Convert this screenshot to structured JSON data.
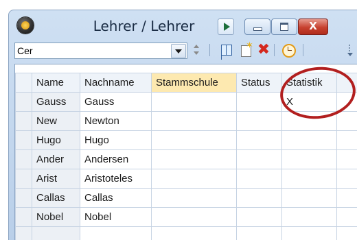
{
  "window": {
    "title": "Lehrer / Lehrer",
    "close_symbol": "X"
  },
  "toolbar": {
    "filter_value": "Cer",
    "icons": [
      "dropdown-arrow-icon",
      "spin-icon",
      "grid-icon",
      "new-record-icon",
      "delete-icon",
      "clock-icon",
      "toolbar-overflow-icon"
    ]
  },
  "table": {
    "columns": [
      "Name",
      "Nachname",
      "Stammschule",
      "Status",
      "Statistik"
    ],
    "rows": [
      {
        "name": "Gauss",
        "nachname": "Gauss",
        "stammschule": "",
        "status": "",
        "statistik": "X"
      },
      {
        "name": "New",
        "nachname": "Newton",
        "stammschule": "",
        "status": "",
        "statistik": ""
      },
      {
        "name": "Hugo",
        "nachname": "Hugo",
        "stammschule": "",
        "status": "",
        "statistik": ""
      },
      {
        "name": "Ander",
        "nachname": "Andersen",
        "stammschule": "",
        "status": "",
        "statistik": ""
      },
      {
        "name": "Arist",
        "nachname": "Aristoteles",
        "stammschule": "",
        "status": "",
        "statistik": ""
      },
      {
        "name": "Callas",
        "nachname": "Callas",
        "stammschule": "",
        "status": "",
        "statistik": ""
      },
      {
        "name": "Nobel",
        "nachname": "Nobel",
        "stammschule": "",
        "status": "",
        "statistik": ""
      }
    ]
  },
  "colors": {
    "highlight_header": "#fde9b0",
    "annotation_circle": "#b21f1f",
    "close_button": "#c7412f"
  }
}
